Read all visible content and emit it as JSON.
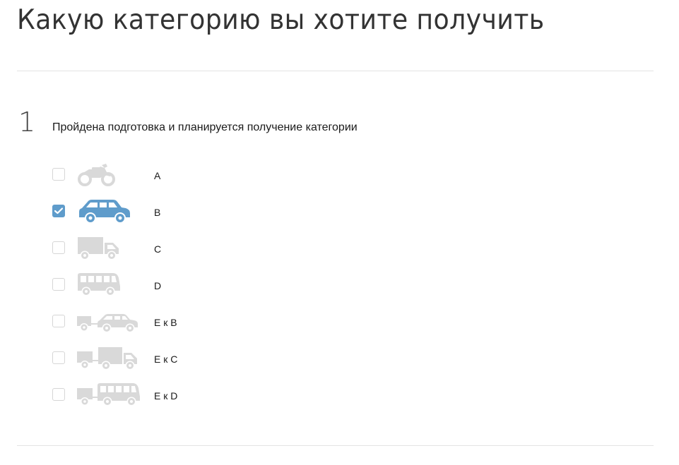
{
  "page": {
    "title": "Какую категорию вы хотите получить"
  },
  "step": {
    "number": "1",
    "heading": "Пройдена подготовка и планируется получение категории"
  },
  "categories": [
    {
      "label": "A",
      "icon": "motorcycle-icon",
      "checked": false
    },
    {
      "label": "B",
      "icon": "car-icon",
      "checked": true
    },
    {
      "label": "C",
      "icon": "truck-icon",
      "checked": false
    },
    {
      "label": "D",
      "icon": "bus-icon",
      "checked": false
    },
    {
      "label": "E к B",
      "icon": "car-with-trailer-icon",
      "checked": false
    },
    {
      "label": "E к C",
      "icon": "truck-with-trailer-icon",
      "checked": false
    },
    {
      "label": "E к D",
      "icon": "bus-with-trailer-icon",
      "checked": false
    }
  ],
  "colors": {
    "accent": "#5f9ccb",
    "inactive_icon": "#d9d9d9",
    "divider": "#e3e3e3"
  }
}
